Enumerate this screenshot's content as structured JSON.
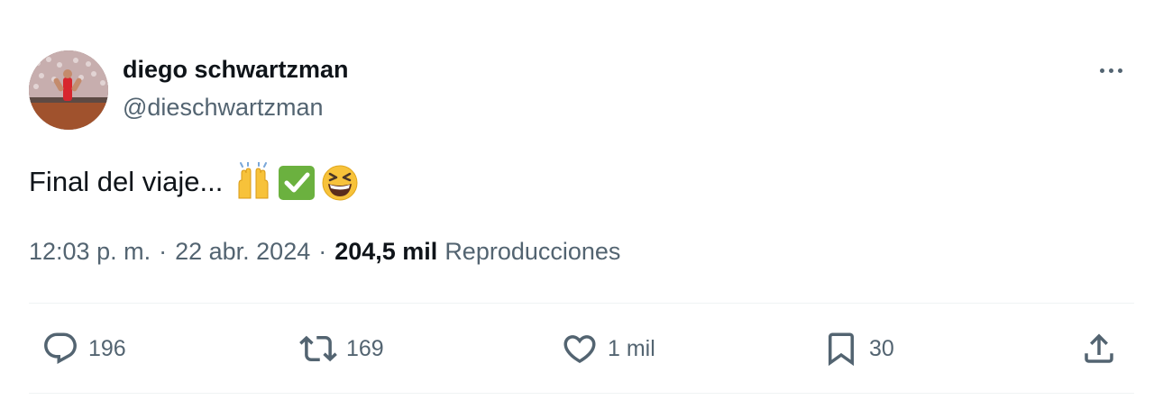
{
  "author": {
    "display_name": "diego schwartzman",
    "handle": "@dieschwartzman"
  },
  "tweet": {
    "text": "Final del viaje...",
    "emojis": [
      "raising-hands-emoji",
      "check-mark-button-emoji",
      "grinning-squinting-face-emoji"
    ]
  },
  "meta": {
    "time": "12:03 p. m.",
    "separator": "·",
    "date": "22 abr. 2024",
    "views_count": "204,5 mil",
    "views_label": "Reproducciones"
  },
  "actions": {
    "replies": "196",
    "retweets": "169",
    "likes": "1 mil",
    "bookmarks": "30"
  },
  "colors": {
    "text": "#0f1419",
    "secondary": "#536471",
    "divider": "#eff3f4",
    "check_green": "#6bb13f",
    "emoji_yellow": "#f7c23a"
  },
  "icons": [
    "more-icon",
    "reply-icon",
    "retweet-icon",
    "like-icon",
    "bookmark-icon",
    "share-icon"
  ]
}
